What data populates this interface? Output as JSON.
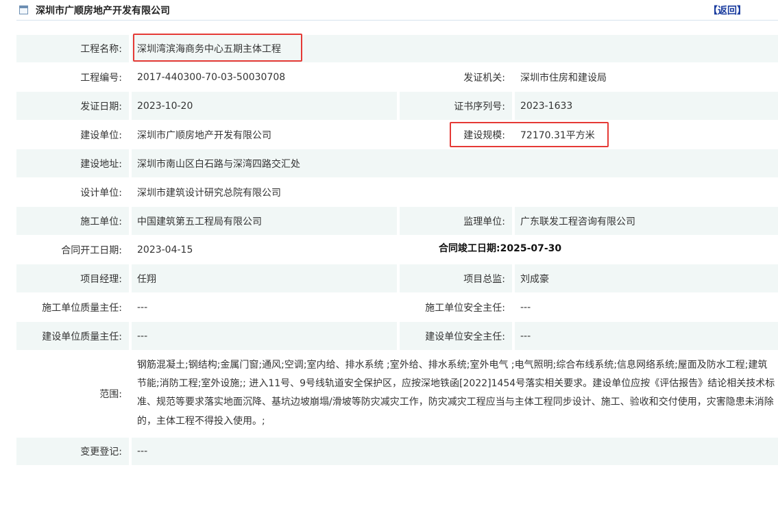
{
  "header": {
    "title": "深圳市广顺房地产开发有限公司",
    "back_label": "【返回】",
    "icon": "window-icon"
  },
  "fields": {
    "project_name": {
      "label": "工程名称:",
      "value": "深圳湾滨海商务中心五期主体工程"
    },
    "project_code": {
      "label": "工程编号:",
      "value": "2017-440300-70-03-50030708"
    },
    "issuer": {
      "label": "发证机关:",
      "value": "深圳市住房和建设局"
    },
    "issue_date": {
      "label": "发证日期:",
      "value": "2023-10-20"
    },
    "cert_serial": {
      "label": "证书序列号:",
      "value": "2023-1633"
    },
    "builder": {
      "label": "建设单位:",
      "value": "深圳市广顺房地产开发有限公司"
    },
    "scale": {
      "label": "建设规模:",
      "value": "72170.31平方米"
    },
    "address": {
      "label": "建设地址:",
      "value": "深圳市南山区白石路与深湾四路交汇处"
    },
    "designer": {
      "label": "设计单位:",
      "value": "深圳市建筑设计研究总院有限公司"
    },
    "contractor": {
      "label": "施工单位:",
      "value": "中国建筑第五工程局有限公司"
    },
    "supervisor_unit": {
      "label": "监理单位:",
      "value": "广东联发工程咨询有限公司"
    },
    "contract_start": {
      "label": "合同开工日期:",
      "value": "2023-04-15"
    },
    "contract_end": {
      "label_value": "合同竣工日期:2025-07-30"
    },
    "project_manager": {
      "label": "项目经理:",
      "value": "任翔"
    },
    "chief_supervisor": {
      "label": "项目总监:",
      "value": "刘成豪"
    },
    "contractor_quality": {
      "label": "施工单位质量主任:",
      "value": "---"
    },
    "contractor_safety": {
      "label": "施工单位安全主任:",
      "value": "---"
    },
    "builder_quality": {
      "label": "建设单位质量主任:",
      "value": "---"
    },
    "builder_safety": {
      "label": "建设单位安全主任:",
      "value": "---"
    },
    "scope": {
      "label": "范围:",
      "value": "钢筋混凝土;钢结构;金属门窗;通风;空调;室内给、排水系统 ;室外给、排水系统;室外电气 ;电气照明;综合布线系统;信息网络系统;屋面及防水工程;建筑节能;消防工程;室外设施;; 进入11号、9号线轨道安全保护区，应按深地铁函[2022]1454号落实相关要求。建设单位应按《评估报告》结论相关技术标准、规范等要求落实地面沉降、基坑边坡崩塌/滑坡等防灾减灾工作，防灾减灾工程应当与主体工程同步设计、施工、验收和交付使用，灾害隐患未消除的，主体工程不得投入使用。;"
    },
    "change_record": {
      "label": "变更登记:",
      "value": "---"
    }
  },
  "colors": {
    "row_shade": "#f1f7f6",
    "highlight_border": "#e53935",
    "back_link": "#1a3c9f"
  }
}
